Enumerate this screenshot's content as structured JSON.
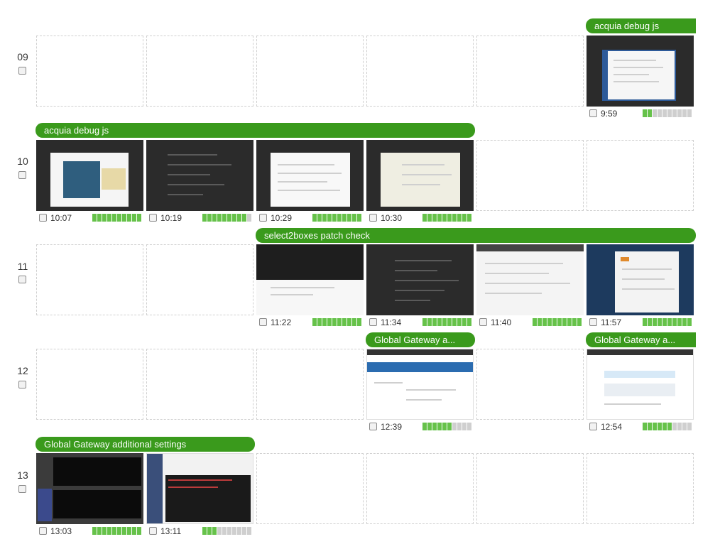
{
  "colors": {
    "accent_green": "#3a9a1c",
    "meter_on": "#66c24a",
    "meter_off": "#cfcfcf"
  },
  "rows": [
    {
      "hour": "09"
    },
    {
      "hour": "10"
    },
    {
      "hour": "11"
    },
    {
      "hour": "12"
    },
    {
      "hour": "13"
    }
  ],
  "sessions": [
    {
      "title": "acquia debug js"
    },
    {
      "title": "acquia debug js"
    },
    {
      "title": "select2boxes patch check"
    },
    {
      "title": "Global Gateway a..."
    },
    {
      "title": "Global Gateway a..."
    },
    {
      "title": "Global Gateway additional settings"
    }
  ],
  "screenshots": [
    {
      "time": "9:59",
      "activity": 2
    },
    {
      "time": "10:07",
      "activity": 10
    },
    {
      "time": "10:19",
      "activity": 9
    },
    {
      "time": "10:29",
      "activity": 10
    },
    {
      "time": "10:30",
      "activity": 10
    },
    {
      "time": "11:22",
      "activity": 10
    },
    {
      "time": "11:34",
      "activity": 10
    },
    {
      "time": "11:40",
      "activity": 10
    },
    {
      "time": "11:57",
      "activity": 10
    },
    {
      "time": "12:39",
      "activity": 6
    },
    {
      "time": "12:54",
      "activity": 6
    },
    {
      "time": "13:03",
      "activity": 10
    },
    {
      "time": "13:11",
      "activity": 3
    }
  ]
}
